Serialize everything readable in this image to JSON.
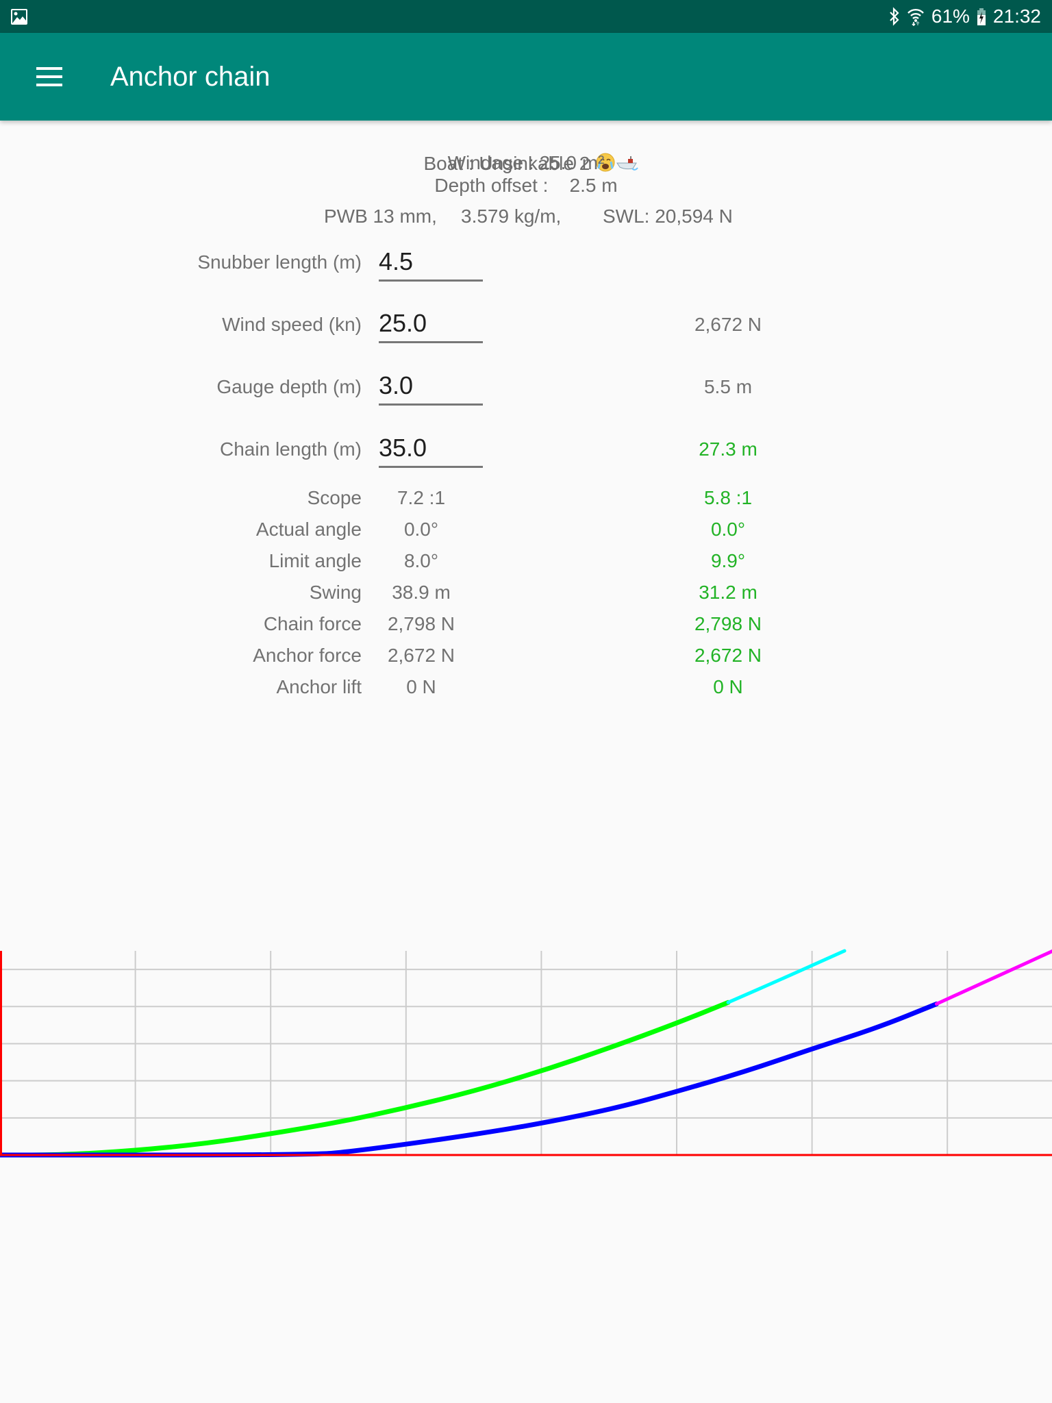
{
  "status_bar": {
    "left_icon": "gallery-icon",
    "icons": [
      "bluetooth-icon",
      "wifi-icon",
      "battery-charging-icon"
    ],
    "battery": "61%",
    "time": "21:32"
  },
  "toolbar": {
    "menu_icon": "hamburger-menu-icon",
    "title": "Anchor chain"
  },
  "boat_info": {
    "boat_line": "Boat : Unsinkable 2 ",
    "boat_emoji": [
      "crying-face-emoji",
      "boat-emoji"
    ],
    "windage_line": "Windage : 25.0 m²",
    "depth_offset_line": "Depth offset :    2.5 m",
    "chain_spec": {
      "pwb": "PWB 13 mm,",
      "weight": "3.579 kg/m,",
      "swl": "SWL: 20,594 N"
    }
  },
  "inputs": [
    {
      "label": "Snubber length (m)",
      "value": "4.5",
      "result": ""
    },
    {
      "label": "Wind speed (kn)",
      "value": "25.0",
      "result": "2,672 N"
    },
    {
      "label": "Gauge depth (m)",
      "value": "3.0",
      "result": "5.5 m"
    },
    {
      "label": "Chain length (m)",
      "value": "35.0",
      "result": "27.3 m"
    }
  ],
  "stats": [
    {
      "label": "Scope",
      "value": "7.2 :1",
      "optimal": "5.8 :1"
    },
    {
      "label": "Actual angle",
      "value": "0.0°",
      "optimal": "0.0°"
    },
    {
      "label": "Limit angle",
      "value": "8.0°",
      "optimal": "9.9°"
    },
    {
      "label": "Swing",
      "value": "38.9 m",
      "optimal": "31.2 m"
    },
    {
      "label": "Chain force",
      "value": "2,798 N",
      "optimal": "2,798 N"
    },
    {
      "label": "Anchor force",
      "value": "2,672 N",
      "optimal": "2,672 N"
    },
    {
      "label": "Anchor lift",
      "value": "0 N",
      "optimal": "0 N"
    }
  ],
  "colors": {
    "status_bar": "#00584d",
    "toolbar": "#00877a",
    "background": "#fafafa",
    "optimal_text": "#22b326",
    "secondary_text": "#727272"
  },
  "chart_data": {
    "type": "line",
    "title": "",
    "xlabel": "",
    "ylabel": "",
    "xlim": [
      0,
      38.9
    ],
    "ylim": [
      0,
      5.5
    ],
    "x_grid_step": 5,
    "y_grid_step": 1,
    "grid": true,
    "axes_color": "#ff0000",
    "grid_color": "#cccccc",
    "series": [
      {
        "name": "optimal-chain",
        "color": "#00ff00",
        "points": [
          [
            0,
            0
          ],
          [
            2.3,
            0
          ],
          [
            5,
            0.12
          ],
          [
            7.6,
            0.31
          ],
          [
            10,
            0.57
          ],
          [
            12.5,
            0.88
          ],
          [
            15,
            1.27
          ],
          [
            17.5,
            1.72
          ],
          [
            20,
            2.26
          ],
          [
            22.5,
            2.88
          ],
          [
            25,
            3.55
          ],
          [
            26.9,
            4.11
          ]
        ]
      },
      {
        "name": "optimal-snubber",
        "color": "#00ffff",
        "points": [
          [
            26.9,
            4.11
          ],
          [
            29,
            4.78
          ],
          [
            31.2,
            5.5
          ]
        ]
      },
      {
        "name": "actual-chain",
        "color": "#0000ff",
        "points": [
          [
            0,
            0
          ],
          [
            11.6,
            0
          ],
          [
            13,
            0.1
          ],
          [
            15,
            0.29
          ],
          [
            17.5,
            0.55
          ],
          [
            20,
            0.85
          ],
          [
            22.8,
            1.27
          ],
          [
            25,
            1.71
          ],
          [
            27.5,
            2.24
          ],
          [
            30,
            2.86
          ],
          [
            32.5,
            3.45
          ],
          [
            34.6,
            4.07
          ]
        ]
      },
      {
        "name": "actual-snubber",
        "color": "#ff00ff",
        "points": [
          [
            34.6,
            4.07
          ],
          [
            36.8,
            4.8
          ],
          [
            38.9,
            5.5
          ]
        ]
      }
    ]
  }
}
